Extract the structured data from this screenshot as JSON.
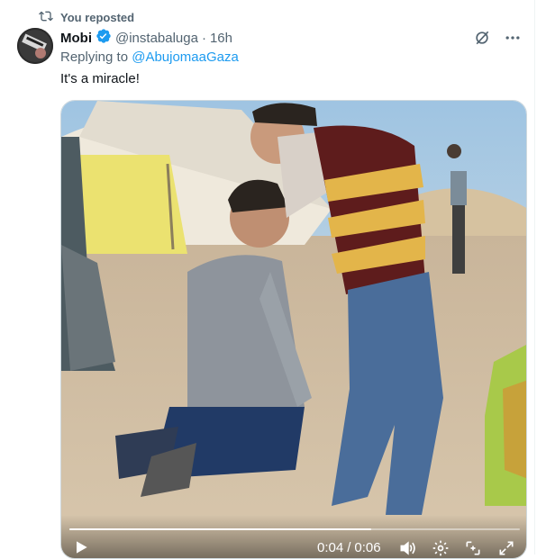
{
  "repost": {
    "label": "You reposted",
    "icon": "repost-icon"
  },
  "author": {
    "name": "Mobi",
    "verified": true,
    "handle": "@instabaluga",
    "separator": "·",
    "time": "16h"
  },
  "reply": {
    "prefix": "Replying to",
    "mention": "@AbujomaaGaza"
  },
  "tweet": {
    "text": "It's a miracle!"
  },
  "video": {
    "current_time": "0:04",
    "separator": "/",
    "duration": "0:06",
    "progress_fraction": 0.67
  },
  "colors": {
    "accent": "#1d9bf0",
    "muted_text": "#536471",
    "text": "#0f1419"
  }
}
